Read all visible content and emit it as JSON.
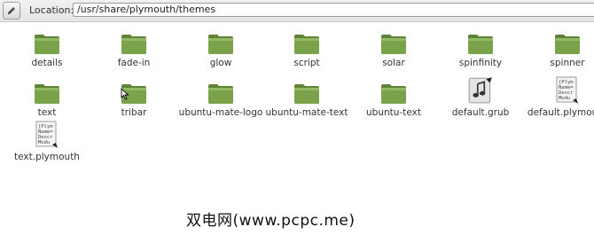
{
  "location": {
    "label": "Location:",
    "path": "/usr/share/plymouth/themes"
  },
  "items": [
    {
      "name": "details",
      "kind": "folder"
    },
    {
      "name": "fade-in",
      "kind": "folder"
    },
    {
      "name": "glow",
      "kind": "folder"
    },
    {
      "name": "script",
      "kind": "folder"
    },
    {
      "name": "solar",
      "kind": "folder"
    },
    {
      "name": "spinfinity",
      "kind": "folder"
    },
    {
      "name": "spinner",
      "kind": "folder"
    },
    {
      "name": "text",
      "kind": "folder"
    },
    {
      "name": "tribar",
      "kind": "folder"
    },
    {
      "name": "ubuntu-mate-logo",
      "kind": "folder"
    },
    {
      "name": "ubuntu-mate-text",
      "kind": "folder"
    },
    {
      "name": "ubuntu-text",
      "kind": "folder"
    },
    {
      "name": "default.grub",
      "kind": "audio-symlink"
    },
    {
      "name": "default.plymouth",
      "kind": "text-symlink"
    },
    {
      "name": "text.plymouth",
      "kind": "text-symlink"
    }
  ],
  "doc_icon_text": "[Plym\nName=\nDescr\nModu",
  "watermark": "双电网(www.pcpc.me)",
  "colors": {
    "folder": "#7aa24a",
    "folder_dark": "#5a7f34"
  }
}
